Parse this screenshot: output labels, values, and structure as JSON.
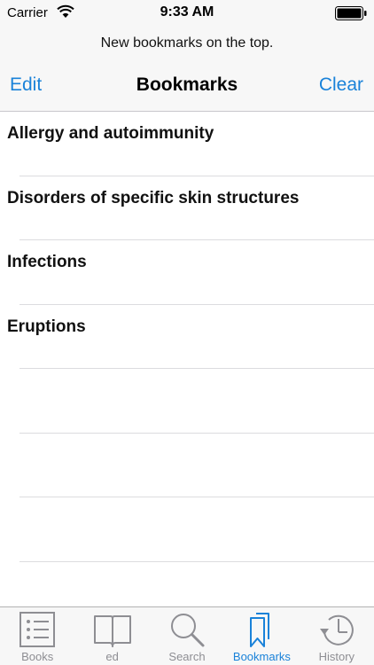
{
  "status": {
    "carrier": "Carrier",
    "time": "9:33 AM"
  },
  "subtitle": "New bookmarks on the top.",
  "nav": {
    "edit_label": "Edit",
    "title": "Bookmarks",
    "clear_label": "Clear"
  },
  "bookmarks": [
    "Allergy and autoimmunity",
    "Disorders of specific skin structures",
    "Infections",
    "Eruptions"
  ],
  "tabs": [
    {
      "label": "Books",
      "icon": "list-icon",
      "active": false
    },
    {
      "label": "ed",
      "icon": "open-book-icon",
      "active": false
    },
    {
      "label": "Search",
      "icon": "magnifier-icon",
      "active": false
    },
    {
      "label": "Bookmarks",
      "icon": "bookmarks-icon",
      "active": true
    },
    {
      "label": "History",
      "icon": "clock-icon",
      "active": false
    }
  ],
  "colors": {
    "accent": "#1a82d9",
    "inactive": "#8e8e93"
  }
}
